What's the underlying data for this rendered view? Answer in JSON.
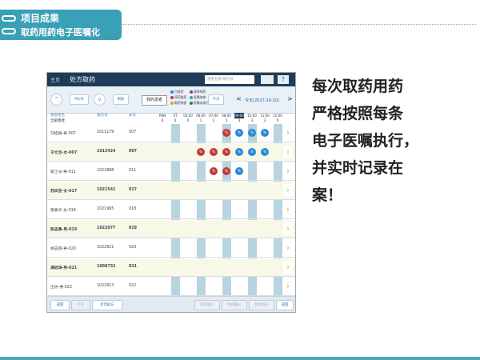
{
  "header": {
    "title": "项目成果",
    "subtitle": "取药用药电子医嘱化"
  },
  "colors": {
    "accent": "#3aa0b6",
    "nav": "#1e3c5a",
    "dot_red": "#c23b3b",
    "dot_blue": "#2a8ad6",
    "band": "#b7d4df"
  },
  "app": {
    "nav_home": "主页",
    "nav_page": "处方取药",
    "search_placeholder": "患者名称/病历号",
    "help_label": "?",
    "toolbar": {
      "prev_label": "^",
      "count_label": "共1条",
      "next_label": "v",
      "refresh_label": "刷新",
      "filter_label": "我的患者",
      "legend": [
        "已给药",
        "暂停给药",
        "停药取药",
        "医嘱待核",
        "取药待核",
        "医嘱未执行"
      ],
      "legend_colors": [
        "#2a8ad6",
        "#8b3a9a",
        "#c23b3b",
        "#3aa0b6",
        "#e09a2a",
        "#2f7a3a"
      ],
      "today_label": "今天",
      "date_prev": "<",
      "date_text": "今天(2017-10-20)",
      "date_next": ">"
    },
    "columns": {
      "name": "患者姓名",
      "mrn": "病历号",
      "bed": "床号"
    },
    "group_label": "全部患者",
    "time_slots": [
      "PRN",
      "ST",
      "03:00",
      "06:00",
      "07:00",
      "08:00",
      "09:00",
      "10:00",
      "11:00",
      "12:00"
    ],
    "slot_counts": [
      "0",
      "0",
      "0",
      "1",
      "2",
      "3",
      "3",
      "3",
      "3",
      "0"
    ],
    "rows": [
      {
        "name": "刘桂梅-男-007",
        "mrn": "1011179",
        "bed": "007",
        "bold": false
      },
      {
        "name": "于文洁-女-007",
        "mrn": "1012424",
        "bed": "007",
        "bold": true
      },
      {
        "name": "蔡士光-男-011",
        "mrn": "1022888",
        "bed": "011",
        "bold": false
      },
      {
        "name": "苏凤芸-女-017",
        "mrn": "1021541",
        "bed": "017",
        "bold": true
      },
      {
        "name": "唐素华-女-018",
        "mrn": "1021965",
        "bed": "018",
        "bold": false
      },
      {
        "name": "陈志勇-男-019",
        "mrn": "1022077",
        "bed": "019",
        "bold": true
      },
      {
        "name": "胡志刚-男-020",
        "mrn": "1022821",
        "bed": "020",
        "bold": false
      },
      {
        "name": "满冠涛-男-021",
        "mrn": "1008732",
        "bed": "021",
        "bold": true
      },
      {
        "name": "王协-男-022",
        "mrn": "1022913",
        "bed": "022",
        "bold": false
      }
    ],
    "chevron": "›",
    "dot_symbol": "%",
    "bottom_buttons": {
      "b1": "返回",
      "b2": "打印",
      "b3": "打印处方",
      "b4": "取药确认",
      "b5": "给药确认",
      "b6": "暂停取药",
      "b7": "返回"
    }
  },
  "right_text": [
    "每次取药用药",
    "严格按照每条",
    "电子医嘱执行，",
    "并实时记录在",
    "案！"
  ]
}
